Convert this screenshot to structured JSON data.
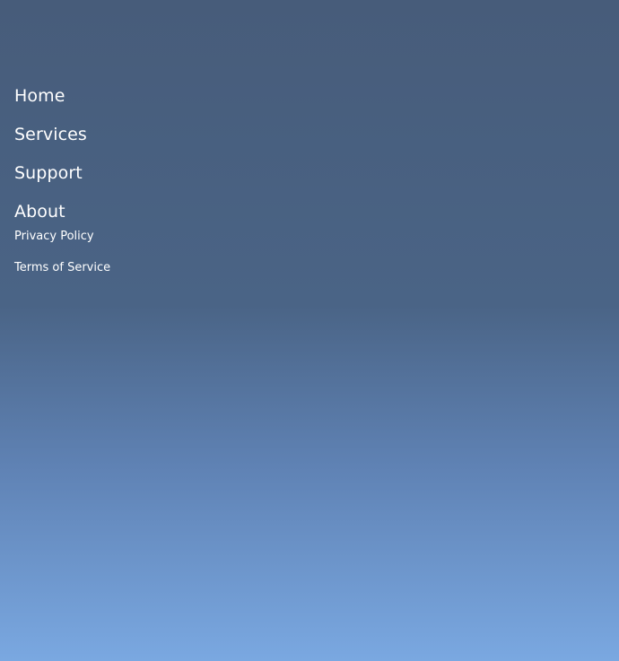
{
  "menu": {
    "primary": [
      {
        "label": "Home"
      },
      {
        "label": "Services"
      },
      {
        "label": "Support"
      },
      {
        "label": "About"
      }
    ],
    "secondary": [
      {
        "label": "Privacy Policy"
      },
      {
        "label": "Terms of Service"
      }
    ]
  },
  "colors": {
    "text": "#ffffff",
    "background_top": "#475c7a",
    "background_bottom": "#7aa8e1"
  }
}
